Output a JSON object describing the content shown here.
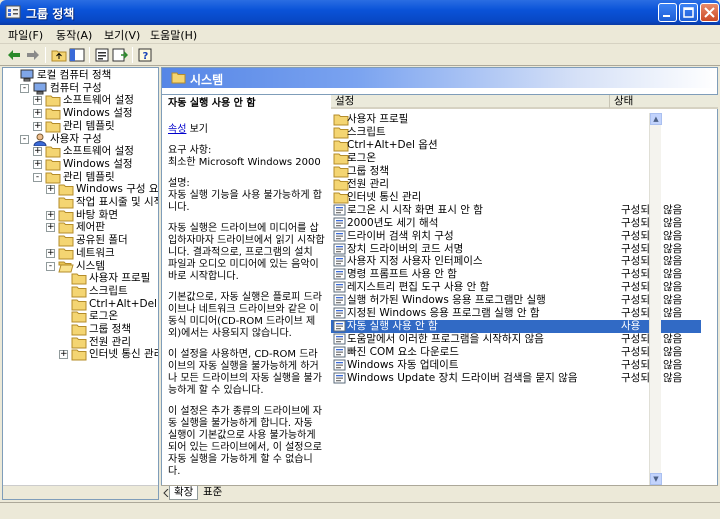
{
  "window": {
    "title": "그룹 정책"
  },
  "menu": [
    "파일(F)",
    "동작(A)",
    "보기(V)",
    "도움말(H)"
  ],
  "tree": [
    {
      "label": "로컬 컴퓨터 정책",
      "level": 0,
      "exp": "",
      "icon": "computer"
    },
    {
      "label": "컴퓨터 구성",
      "level": 1,
      "exp": "-",
      "icon": "computer"
    },
    {
      "label": "소프트웨어 설정",
      "level": 2,
      "exp": "+",
      "icon": "folder"
    },
    {
      "label": "Windows 설정",
      "level": 2,
      "exp": "+",
      "icon": "folder"
    },
    {
      "label": "관리 템플릿",
      "level": 2,
      "exp": "+",
      "icon": "folder"
    },
    {
      "label": "사용자 구성",
      "level": 1,
      "exp": "-",
      "icon": "user"
    },
    {
      "label": "소프트웨어 설정",
      "level": 2,
      "exp": "+",
      "icon": "folder"
    },
    {
      "label": "Windows 설정",
      "level": 2,
      "exp": "+",
      "icon": "folder"
    },
    {
      "label": "관리 템플릿",
      "level": 2,
      "exp": "-",
      "icon": "folder"
    },
    {
      "label": "Windows 구성 요소",
      "level": 3,
      "exp": "+",
      "icon": "folder"
    },
    {
      "label": "작업 표시줄 및 시작",
      "level": 3,
      "exp": "",
      "icon": "folder"
    },
    {
      "label": "바탕 화면",
      "level": 3,
      "exp": "+",
      "icon": "folder"
    },
    {
      "label": "제어판",
      "level": 3,
      "exp": "+",
      "icon": "folder"
    },
    {
      "label": "공유된 폴더",
      "level": 3,
      "exp": "",
      "icon": "folder"
    },
    {
      "label": "네트워크",
      "level": 3,
      "exp": "+",
      "icon": "folder"
    },
    {
      "label": "시스템",
      "level": 3,
      "exp": "-",
      "icon": "folder-open"
    },
    {
      "label": "사용자 프로필",
      "level": 4,
      "exp": "",
      "icon": "folder"
    },
    {
      "label": "스크립트",
      "level": 4,
      "exp": "",
      "icon": "folder"
    },
    {
      "label": "Ctrl+Alt+Del 옵션",
      "level": 4,
      "exp": "",
      "icon": "folder"
    },
    {
      "label": "로그온",
      "level": 4,
      "exp": "",
      "icon": "folder"
    },
    {
      "label": "그룹 정책",
      "level": 4,
      "exp": "",
      "icon": "folder"
    },
    {
      "label": "전원 관리",
      "level": 4,
      "exp": "",
      "icon": "folder"
    },
    {
      "label": "인터넷 통신 관리",
      "level": 4,
      "exp": "+",
      "icon": "folder"
    }
  ],
  "header": {
    "title": "시스템"
  },
  "description": {
    "title": "자동 실행 사용 안 함",
    "properties_link": "속성",
    "properties_suffix": " 보기",
    "requirements": "요구 사항:\n최소한 Microsoft Windows 2000",
    "explanation_label": "설명:",
    "explanation": "자동 실행 기능을 사용 불가능하게 합니다.",
    "p2": "자동 실행은 드라이브에 미디어를 삽입하자마자 드라이브에서 읽기 시작합니다. 결과적으로, 프로그램의 설치 파일과 오디오 미디어에 있는 음악이 바로 시작합니다.",
    "p3": "기본값으로, 자동 실행은 플로피 드라이브나 네트워크 드라이브와 같은 이동식 미디어(CD-ROM 드라이브 제외)에서는 사용되지 않습니다.",
    "p4": "이 설정을 사용하면, CD-ROM 드라이브의 자동 실행을 불가능하게 하거나 모든 드라이브의 자동 실행을 불가능하게 할 수 있습니다.",
    "p5": "이 설정은 추가 종류의 드라이브에 자동 실행을 불가능하게 합니다. 자동 실행이 기본값으로 사용 불가능하게 되어 있는 드라이브에서, 이 설정으로 자동 실행을 가능하게 할 수 없습니다."
  },
  "list": {
    "columns": {
      "name": "설정",
      "state": "상태"
    },
    "rows": [
      {
        "name": "사용자 프로필",
        "state": "",
        "icon": "folder"
      },
      {
        "name": "스크립트",
        "state": "",
        "icon": "folder"
      },
      {
        "name": "Ctrl+Alt+Del 옵션",
        "state": "",
        "icon": "folder"
      },
      {
        "name": "로그온",
        "state": "",
        "icon": "folder"
      },
      {
        "name": "그룹 정책",
        "state": "",
        "icon": "folder"
      },
      {
        "name": "전원 관리",
        "state": "",
        "icon": "folder"
      },
      {
        "name": "인터넷 통신 관리",
        "state": "",
        "icon": "folder"
      },
      {
        "name": "로그온 시 시작 화면 표시 안 함",
        "state": "구성되지 않음",
        "icon": "policy"
      },
      {
        "name": "2000년도 세기 해석",
        "state": "구성되지 않음",
        "icon": "policy"
      },
      {
        "name": "드라이버 검색 위치 구성",
        "state": "구성되지 않음",
        "icon": "policy"
      },
      {
        "name": "장치 드라이버의 코드 서명",
        "state": "구성되지 않음",
        "icon": "policy"
      },
      {
        "name": "사용자 지정 사용자 인터페이스",
        "state": "구성되지 않음",
        "icon": "policy"
      },
      {
        "name": "명령 프롬프트 사용 안 함",
        "state": "구성되지 않음",
        "icon": "policy"
      },
      {
        "name": "레지스트리 편집 도구 사용 안 함",
        "state": "구성되지 않음",
        "icon": "policy"
      },
      {
        "name": "실행 허가된 Windows 응용 프로그램만 실행",
        "state": "구성되지 않음",
        "icon": "policy"
      },
      {
        "name": "지정된 Windows 응용 프로그램 실행 안 함",
        "state": "구성되지 않음",
        "icon": "policy"
      },
      {
        "name": "자동 실행 사용 안 함",
        "state": "사용",
        "icon": "policy",
        "selected": true
      },
      {
        "name": "도움말에서 이러한 프로그램을 시작하지 않음",
        "state": "구성되지 않음",
        "icon": "policy"
      },
      {
        "name": "빠진 COM 요소 다운로드",
        "state": "구성되지 않음",
        "icon": "policy"
      },
      {
        "name": "Windows 자동 업데이트",
        "state": "구성되지 않음",
        "icon": "policy"
      },
      {
        "name": "Windows Update 장치 드라이버 검색을 묻지 않음",
        "state": "구성되지 않음",
        "icon": "policy"
      }
    ]
  },
  "tabs": [
    {
      "label": "확장",
      "active": true
    },
    {
      "label": "표준",
      "active": false
    }
  ]
}
